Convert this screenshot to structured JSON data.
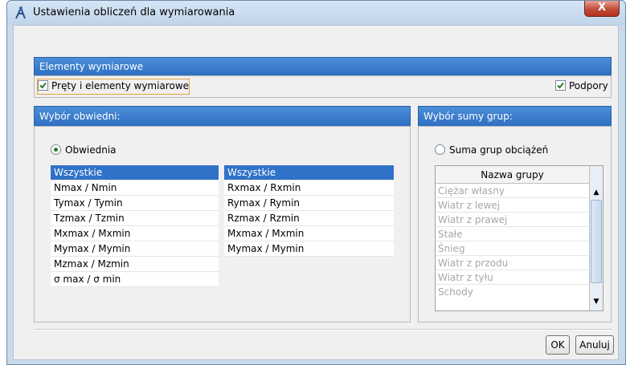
{
  "window": {
    "title": "Ustawienia obliczeń dla wymiarowania",
    "close_label": "X"
  },
  "elements_section": {
    "header": "Elementy wymiarowe",
    "bars_checkbox": {
      "label": "Pręty i elementy wymiarowe",
      "checked": true
    },
    "supports_checkbox": {
      "label": "Podpory",
      "checked": true
    }
  },
  "envelope_section": {
    "header": "Wybór obwiedni:",
    "radio": {
      "label": "Obwiednia",
      "selected": true
    },
    "left_list": [
      "Wszystkie",
      "Nmax / Nmin",
      "Tymax / Tymin",
      "Tzmax / Tzmin",
      "Mxmax / Mxmin",
      "Mymax / Mymin",
      "Mzmax / Mzmin",
      "σ max / σ min"
    ],
    "right_list": [
      "Wszystkie",
      "Rxmax / Rxmin",
      "Rymax / Rymin",
      "Rzmax / Rzmin",
      "Mxmax / Mxmin",
      "Mymax / Mymin"
    ],
    "selected_left": "Wszystkie",
    "selected_right": "Wszystkie"
  },
  "groups_section": {
    "header": "Wybór sumy grup:",
    "radio": {
      "label": "Suma grup obciążeń",
      "selected": false
    },
    "column_header": "Nazwa grupy",
    "groups": [
      "Ciężar własny",
      "Wiatr z lewej",
      "Wiatr z prawej",
      "Stałe",
      "Śnieg",
      "Wiatr z przodu",
      "Wiatr z tyłu",
      "Schody"
    ]
  },
  "buttons": {
    "ok": "OK",
    "cancel": "Anuluj"
  },
  "colors": {
    "header_blue": "#3a7fd0",
    "selection_blue": "#3072c8",
    "disabled_text": "#a7a7a7",
    "check_green": "#2a7a2a"
  },
  "icons": {
    "app": "app-crane-icon",
    "close": "close-icon",
    "check": "checkmark-icon",
    "scroll_up": "arrow-up-icon",
    "scroll_down": "arrow-down-icon"
  }
}
